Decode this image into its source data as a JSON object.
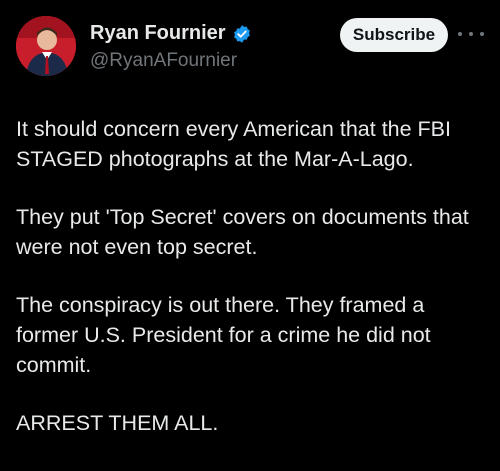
{
  "author": {
    "display_name": "Ryan Fournier",
    "handle": "@RyanAFournier",
    "verified": true,
    "avatar_icon": "profile-photo"
  },
  "actions": {
    "subscribe_label": "Subscribe",
    "more_icon": "more-dots-icon"
  },
  "post": {
    "paragraphs": [
      "It should concern every American that the FBI STAGED photographs at the Mar-A-Lago.",
      "They put 'Top Secret' covers on documents that were not even top secret.",
      "The conspiracy is out there. They framed a former U.S. President for a crime he did not commit.",
      "ARREST THEM ALL."
    ]
  },
  "colors": {
    "background": "#000000",
    "text_primary": "#e7e9ea",
    "text_secondary": "#71767b",
    "verified_blue": "#1d9bf0",
    "button_bg": "#eff3f4"
  }
}
